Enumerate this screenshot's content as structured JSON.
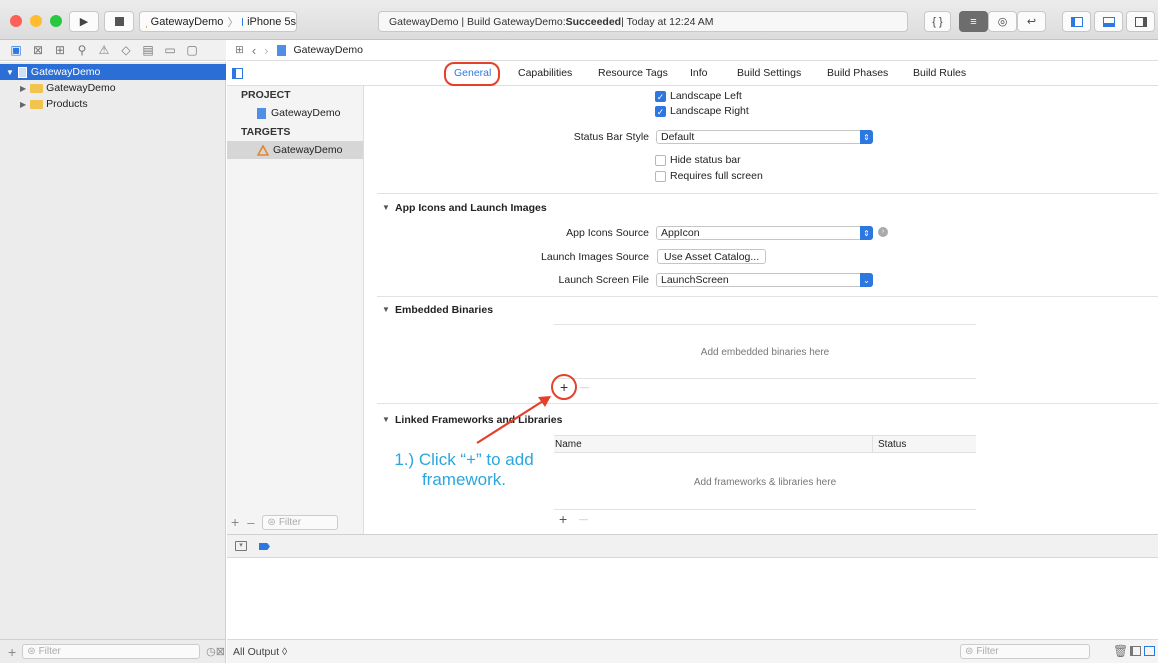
{
  "toolbar": {
    "scheme_project": "GatewayDemo",
    "scheme_separator": "〉",
    "scheme_device": "iPhone 5s",
    "activity_prefix": "GatewayDemo | Build GatewayDemo: ",
    "activity_status": "Succeeded",
    "activity_suffix": " | Today at 12:24 AM",
    "code_button": "{ }"
  },
  "navigator": {
    "items": [
      {
        "label": "GatewayDemo",
        "kind": "project",
        "selected": true
      },
      {
        "label": "GatewayDemo",
        "kind": "folder"
      },
      {
        "label": "Products",
        "kind": "folder"
      }
    ],
    "filter_placeholder": "Filter"
  },
  "jumpbar": {
    "file": "GatewayDemo"
  },
  "tabs": [
    "General",
    "Capabilities",
    "Resource Tags",
    "Info",
    "Build Settings",
    "Build Phases",
    "Build Rules"
  ],
  "outline": {
    "project_header": "PROJECT",
    "project_item": "GatewayDemo",
    "targets_header": "TARGETS",
    "target_item": "GatewayDemo",
    "filter_placeholder": "Filter"
  },
  "settings": {
    "landscape_left": "Landscape Left",
    "landscape_right": "Landscape Right",
    "status_bar_style_label": "Status Bar Style",
    "status_bar_style_value": "Default",
    "hide_status_bar": "Hide status bar",
    "requires_full_screen": "Requires full screen",
    "app_icons_section": "App Icons and Launch Images",
    "app_icons_source_label": "App Icons Source",
    "app_icons_source_value": "AppIcon",
    "launch_images_source_label": "Launch Images Source",
    "launch_images_source_button": "Use Asset Catalog...",
    "launch_screen_file_label": "Launch Screen File",
    "launch_screen_file_value": "LaunchScreen",
    "embedded_section": "Embedded Binaries",
    "embedded_empty": "Add embedded binaries here",
    "linked_section": "Linked Frameworks and Libraries",
    "col_name": "Name",
    "col_status": "Status",
    "linked_empty": "Add frameworks & libraries here",
    "add_symbol": "+",
    "remove_symbol": "—"
  },
  "annotation": {
    "callout_line1": "1.) Click “+” to add",
    "callout_line2": "framework."
  },
  "console": {
    "output_selector": "All Output ◊",
    "filter_placeholder": "Filter"
  },
  "colors": {
    "accent": "#2d77e0",
    "annotation_red": "#e5402a",
    "callout_blue": "#2aa7df"
  }
}
